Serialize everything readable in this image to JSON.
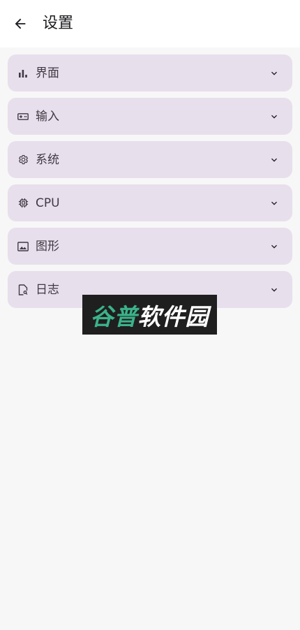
{
  "appbar": {
    "title": "设置",
    "back_icon": "arrow-back-icon"
  },
  "settings": {
    "items": [
      {
        "label": "界面",
        "icon": "bar-chart-icon"
      },
      {
        "label": "输入",
        "icon": "gamepad-icon"
      },
      {
        "label": "系统",
        "icon": "gear-icon"
      },
      {
        "label": "CPU",
        "icon": "cpu-chip-icon"
      },
      {
        "label": "图形",
        "icon": "image-icon"
      },
      {
        "label": "日志",
        "icon": "file-search-icon"
      }
    ],
    "expand_icon": "chevron-down-icon"
  },
  "watermark": {
    "text_green": "谷普",
    "text_white": "软件园"
  },
  "colors": {
    "card": "#e8dfec",
    "background": "#f7f7f7",
    "appbar": "#ffffff",
    "watermark_green": "#3bb38a"
  }
}
